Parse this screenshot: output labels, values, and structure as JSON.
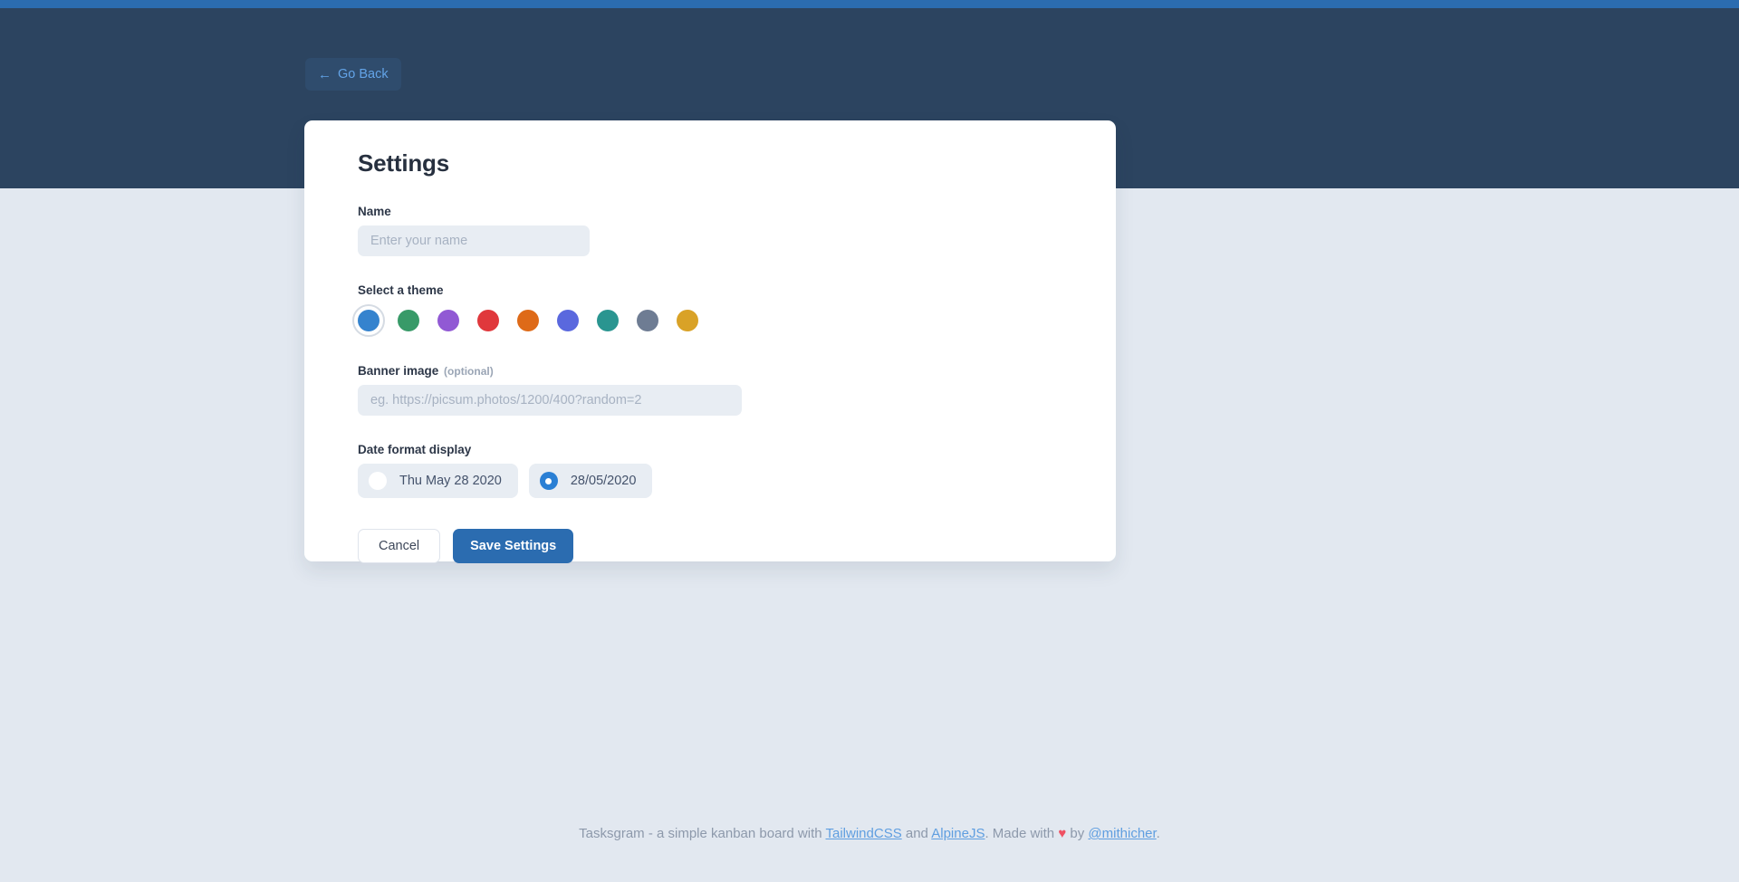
{
  "theme_colors": {
    "accent_strip": "#2b6cb0",
    "header_band": "#2c4460",
    "page_background": "#e2e8f0",
    "card_background": "#ffffff"
  },
  "header": {
    "go_back_label": "Go Back",
    "go_back_arrow": "←"
  },
  "card": {
    "title": "Settings",
    "name": {
      "label": "Name",
      "value": "",
      "placeholder": "Enter your name"
    },
    "theme": {
      "label": "Select a theme",
      "selected_index": 0,
      "swatches": [
        {
          "name": "blue",
          "color": "#3583ce"
        },
        {
          "name": "green",
          "color": "#389a68"
        },
        {
          "name": "purple",
          "color": "#9159d4"
        },
        {
          "name": "red",
          "color": "#e0383c"
        },
        {
          "name": "orange",
          "color": "#de6a18"
        },
        {
          "name": "indigo",
          "color": "#5a68de"
        },
        {
          "name": "teal",
          "color": "#2a9590"
        },
        {
          "name": "gray",
          "color": "#6e7c93"
        },
        {
          "name": "yellow",
          "color": "#d9a227"
        }
      ]
    },
    "banner": {
      "label": "Banner image",
      "optional_tag": "(optional)",
      "value": "",
      "placeholder": "eg. https://picsum.photos/1200/400?random=2"
    },
    "date_format": {
      "label": "Date format display",
      "selected_index": 1,
      "options": [
        {
          "label": "Thu May 28 2020",
          "checked": false
        },
        {
          "label": "28/05/2020",
          "checked": true
        }
      ]
    },
    "actions": {
      "cancel_label": "Cancel",
      "save_label": "Save Settings"
    }
  },
  "footer": {
    "text_start": "Tasksgram - a simple kanban board with ",
    "link_tailwind": "TailwindCSS",
    "text_and": " and ",
    "link_alpine": "AlpineJS",
    "text_made": ". Made with ",
    "heart": "♥",
    "text_by": " by ",
    "link_author": "@mithicher",
    "text_end": "."
  }
}
